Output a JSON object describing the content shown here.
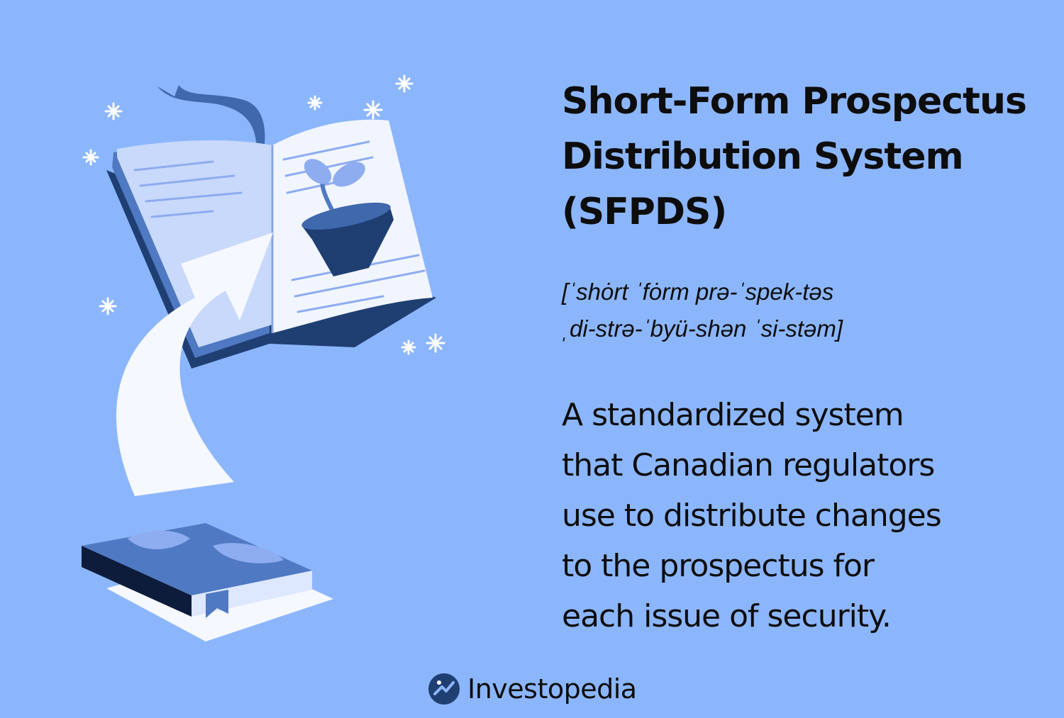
{
  "title": {
    "lines": [
      "Short-Form Prospectus",
      "Distribution System",
      "(SFPDS)"
    ]
  },
  "pronunciation": {
    "lines": [
      "[ˈshȯrt ˈfȯrm prə-ˈspek-təs",
      "ˌdi-strə-ˈbyü-shən ˈsi-stəm]"
    ]
  },
  "definition": {
    "lines": [
      "A standardized system",
      "that Canadian regulators",
      "use to distribute changes",
      "to the prospectus for",
      "each issue of security."
    ]
  },
  "brand": {
    "name": "Investopedia",
    "icon": "investopedia-logo-icon"
  },
  "colors": {
    "background": "#8cb6fc",
    "navy": "#1f3f73",
    "mid_blue": "#4f79c2",
    "page_light": "#dde7ff",
    "text": "#0d0d0d"
  }
}
